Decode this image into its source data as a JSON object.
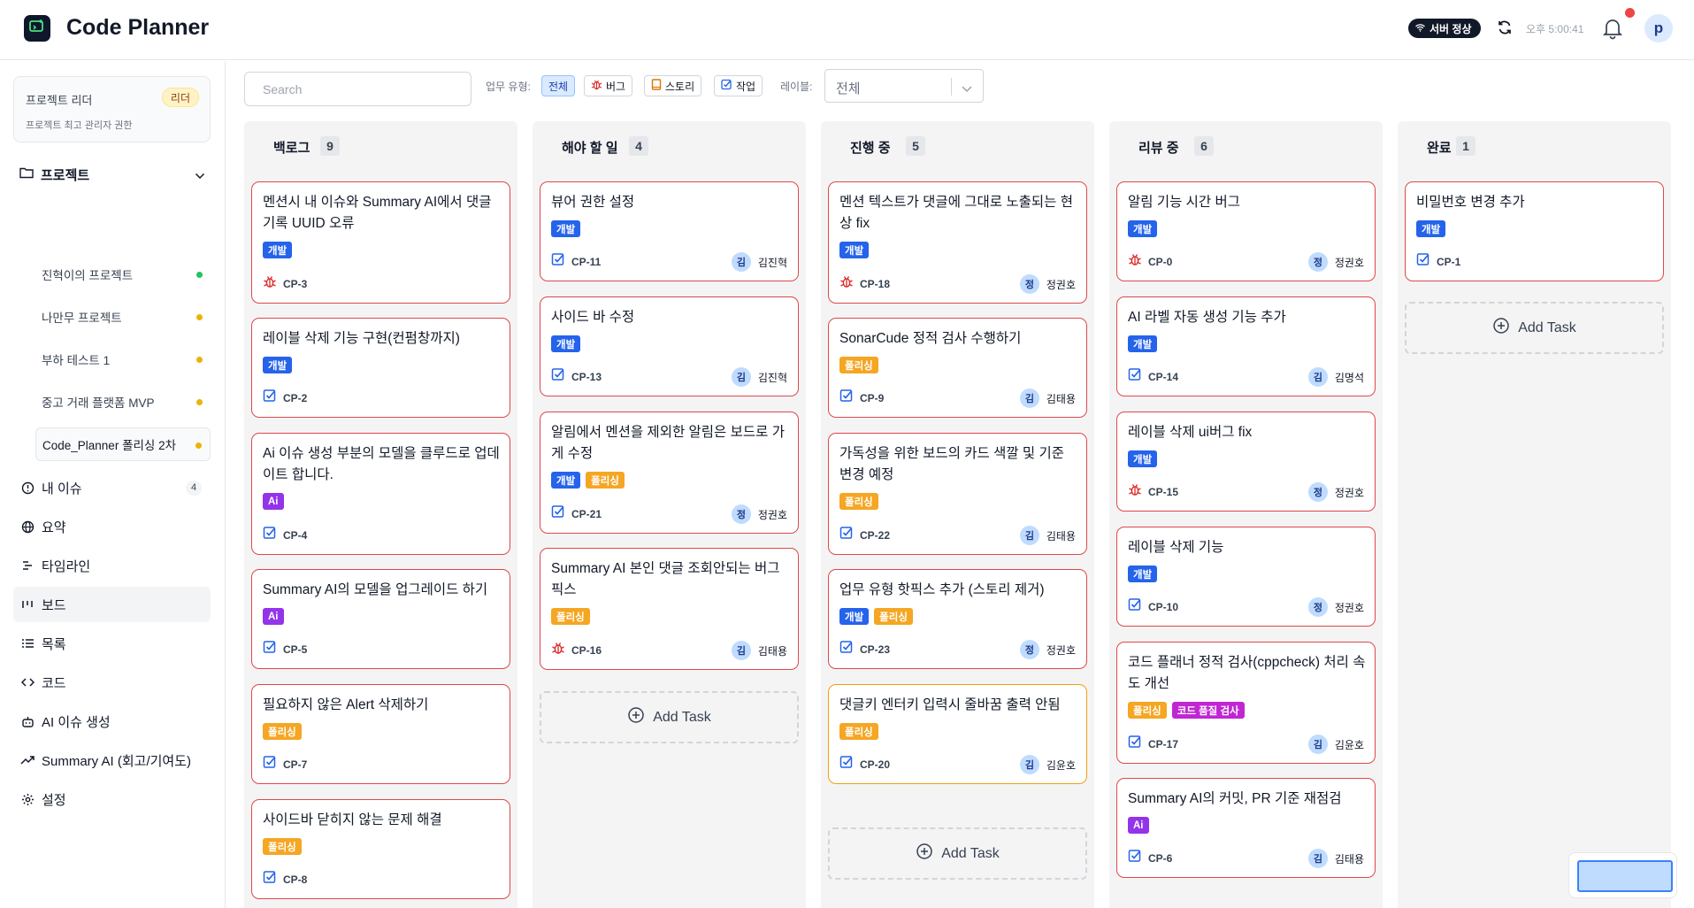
{
  "header": {
    "app_title": "Code Planner",
    "server_status": "서버 정상",
    "clock": "오후 5:00:41",
    "user_initial": "p"
  },
  "sidebar": {
    "role": {
      "title": "프로젝트 리더",
      "badge": "리더",
      "description": "프로젝트 최고 관리자 권한"
    },
    "projects_label": "프로젝트",
    "projects": [
      {
        "name": "진혁이의 프로젝트",
        "dot_color": "#22c55e"
      },
      {
        "name": "나만무 프로젝트",
        "dot_color": "#eab308"
      },
      {
        "name": "부하 테스트 1",
        "dot_color": "#eab308"
      },
      {
        "name": "중고 거래 플랫폼 MVP",
        "dot_color": "#eab308"
      },
      {
        "name": "Code_Planner 폴리싱 2차",
        "dot_color": "#eab308"
      }
    ],
    "nav": [
      {
        "label": "내 이슈",
        "icon": "alert-circle-icon",
        "count": "4"
      },
      {
        "label": "요약",
        "icon": "globe-icon"
      },
      {
        "label": "타임라인",
        "icon": "timeline-icon"
      },
      {
        "label": "보드",
        "icon": "board-icon"
      },
      {
        "label": "목록",
        "icon": "list-icon"
      },
      {
        "label": "코드",
        "icon": "code-icon"
      },
      {
        "label": "AI 이슈 생성",
        "icon": "robot-icon"
      },
      {
        "label": "Summary AI (회고/기여도)",
        "icon": "trending-up-icon"
      },
      {
        "label": "설정",
        "icon": "gear-icon"
      }
    ]
  },
  "filters": {
    "search_placeholder": "Search",
    "type_label": "업무 유형:",
    "types": [
      "전체",
      "버그",
      "스토리",
      "작업"
    ],
    "label_label": "레이블:",
    "label_value": "전체"
  },
  "columns": [
    {
      "title": "백로그",
      "count": "9",
      "cards": [
        {
          "title": "멘션시 내 이슈와 Summary AI에서 댓글 기록 UUID 오류",
          "tags": [
            "개발"
          ],
          "key": "CP-3",
          "type": "bug"
        },
        {
          "title": "레이블 삭제 기능 구현(컨펌창까지)",
          "tags": [
            "개발"
          ],
          "key": "CP-2",
          "type": "task"
        },
        {
          "title": "Ai 이슈 생성 부분의 모델을 클루드로 업데이트 합니다.",
          "tags": [
            "Ai"
          ],
          "key": "CP-4",
          "type": "task"
        },
        {
          "title": "Summary AI의 모델을 업그레이드 하기",
          "tags": [
            "Ai"
          ],
          "key": "CP-5",
          "type": "task"
        },
        {
          "title": "필요하지 않은 Alert 삭제하기",
          "tags": [
            "폴리싱"
          ],
          "key": "CP-7",
          "type": "task"
        },
        {
          "title": "사이드바 닫히지 않는 문제 해결",
          "tags": [
            "폴리싱"
          ],
          "key": "CP-8",
          "type": "task"
        }
      ]
    },
    {
      "title": "해야 할 일",
      "count": "4",
      "cards": [
        {
          "title": "뷰어 권한 설정",
          "tags": [
            "개발"
          ],
          "key": "CP-11",
          "type": "task",
          "av": "김",
          "assignee": "김진혁"
        },
        {
          "title": "사이드 바 수정",
          "tags": [
            "개발"
          ],
          "key": "CP-13",
          "type": "task",
          "av": "김",
          "assignee": "김진혁"
        },
        {
          "title": "알림에서 멘션을 제외한 알림은 보드로 가게 수정",
          "tags": [
            "개발",
            "폴리싱"
          ],
          "key": "CP-21",
          "type": "task",
          "av": "정",
          "assignee": "정권호"
        },
        {
          "title": "Summary AI 본인 댓글 조회안되는 버그 픽스",
          "tags": [
            "폴리싱"
          ],
          "key": "CP-16",
          "type": "bug",
          "av": "김",
          "assignee": "김태용"
        }
      ],
      "add_label": "Add Task"
    },
    {
      "title": "진행 중",
      "count": "5",
      "cards": [
        {
          "title": "멘션 텍스트가 댓글에 그대로 노출되는 현상 fix",
          "tags": [
            "개발"
          ],
          "key": "CP-18",
          "type": "bug",
          "av": "정",
          "assignee": "정권호"
        },
        {
          "title": "SonarCude 정적 검사 수행하기",
          "tags": [
            "폴리싱"
          ],
          "key": "CP-9",
          "type": "task",
          "av": "김",
          "assignee": "김태용"
        },
        {
          "title": "가독성을 위한 보드의 카드 색깔 및 기준 변경 예정",
          "tags": [
            "폴리싱"
          ],
          "key": "CP-22",
          "type": "task",
          "av": "김",
          "assignee": "김태용"
        },
        {
          "title": "업무 유형 핫픽스 추가 (스토리 제거)",
          "tags": [
            "개발",
            "폴리싱"
          ],
          "key": "CP-23",
          "type": "task",
          "av": "정",
          "assignee": "정권호"
        },
        {
          "title": "댓글키 엔터키 입력시 줄바꿈 출력 안됨",
          "tags": [
            "폴리싱"
          ],
          "key": "CP-20",
          "type": "task",
          "av": "김",
          "assignee": "김윤호",
          "orange": true
        }
      ],
      "add_label": "Add Task"
    },
    {
      "title": "리뷰 중",
      "count": "6",
      "cards": [
        {
          "title": "알림 기능 시간 버그",
          "tags": [
            "개발"
          ],
          "key": "CP-0",
          "type": "bug",
          "av": "정",
          "assignee": "정권호"
        },
        {
          "title": "AI 라벨 자동 생성 기능 추가",
          "tags": [
            "개발"
          ],
          "key": "CP-14",
          "type": "task",
          "av": "김",
          "assignee": "김명석"
        },
        {
          "title": "레이블 삭제 ui버그 fix",
          "tags": [
            "개발"
          ],
          "key": "CP-15",
          "type": "bug",
          "av": "정",
          "assignee": "정권호"
        },
        {
          "title": "레이블 삭제 기능",
          "tags": [
            "개발"
          ],
          "key": "CP-10",
          "type": "task",
          "av": "정",
          "assignee": "정권호"
        },
        {
          "title": "코드 플래너 정적 검사(cppcheck) 처리 속도 개선",
          "tags": [
            "폴리싱",
            "코드 품질 검사"
          ],
          "key": "CP-17",
          "type": "task",
          "av": "김",
          "assignee": "김윤호"
        },
        {
          "title": "Summary AI의 커밋, PR 기준 재점검",
          "tags": [
            "Ai"
          ],
          "key": "CP-6",
          "type": "task",
          "av": "김",
          "assignee": "김태용"
        }
      ]
    },
    {
      "title": "완료",
      "count": "1",
      "cards": [
        {
          "title": "비밀번호 변경 추가",
          "tags": [
            "개발"
          ],
          "key": "CP-1",
          "type": "task"
        }
      ],
      "add_label": "Add Task"
    }
  ]
}
